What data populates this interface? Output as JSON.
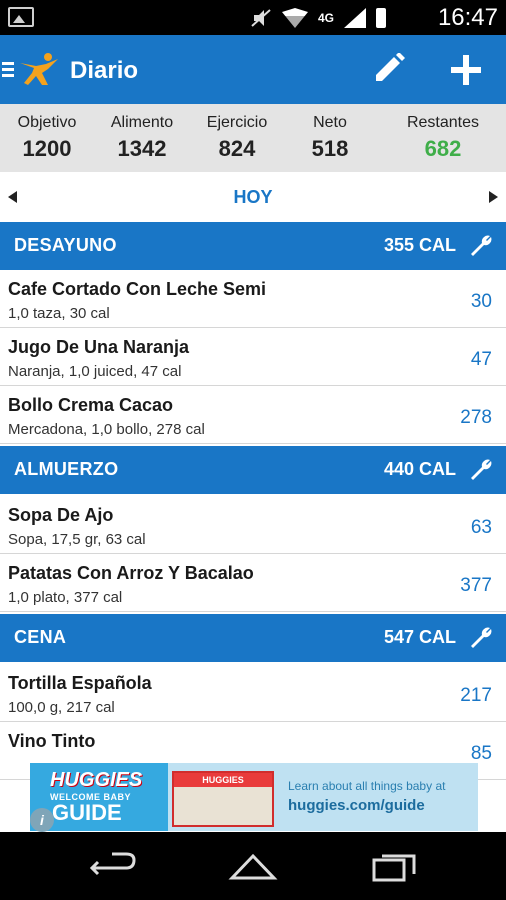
{
  "status_bar": {
    "time": "16:47",
    "network": "4G"
  },
  "header": {
    "title": "Diario"
  },
  "summary": [
    {
      "label": "Objetivo",
      "value": "1200"
    },
    {
      "label": "Alimento",
      "value": "1342"
    },
    {
      "label": "Ejercicio",
      "value": "824"
    },
    {
      "label": "Neto",
      "value": "518"
    },
    {
      "label": "Restantes",
      "value": "682"
    }
  ],
  "date_nav": {
    "label": "HOY"
  },
  "meals": [
    {
      "name": "DESAYUNO",
      "calories": "355 CAL",
      "entries": [
        {
          "title": "Cafe Cortado Con Leche Semi",
          "detail": "1,0 taza, 30 cal",
          "calories": "30"
        },
        {
          "title": "Jugo De Una Naranja",
          "detail": "Naranja, 1,0 juiced, 47 cal",
          "calories": "47"
        },
        {
          "title": "Bollo Crema Cacao",
          "detail": "Mercadona, 1,0 bollo, 278 cal",
          "calories": "278"
        }
      ]
    },
    {
      "name": "ALMUERZO",
      "calories": "440 CAL",
      "entries": [
        {
          "title": "Sopa De Ajo",
          "detail": "Sopa, 17,5 gr, 63 cal",
          "calories": "63"
        },
        {
          "title": "Patatas Con Arroz Y Bacalao",
          "detail": "1,0 plato, 377 cal",
          "calories": "377"
        }
      ]
    },
    {
      "name": "CENA",
      "calories": "547 CAL",
      "entries": [
        {
          "title": "Tortilla Española",
          "detail": "100,0 g, 217 cal",
          "calories": "217"
        },
        {
          "title": "Vino Tinto",
          "detail": "",
          "calories": "85"
        }
      ]
    }
  ],
  "ad": {
    "brand": "HUGGIES",
    "tagline": "WELCOME BABY",
    "guide": "GUIDE",
    "pack_label": "HUGGIES",
    "text": "Learn about all things baby at",
    "url": "huggies.com/guide",
    "info": "i"
  },
  "colors": {
    "primary": "#1976c6",
    "remaining": "#3fae49",
    "summary_bg": "#e4e4e4"
  }
}
